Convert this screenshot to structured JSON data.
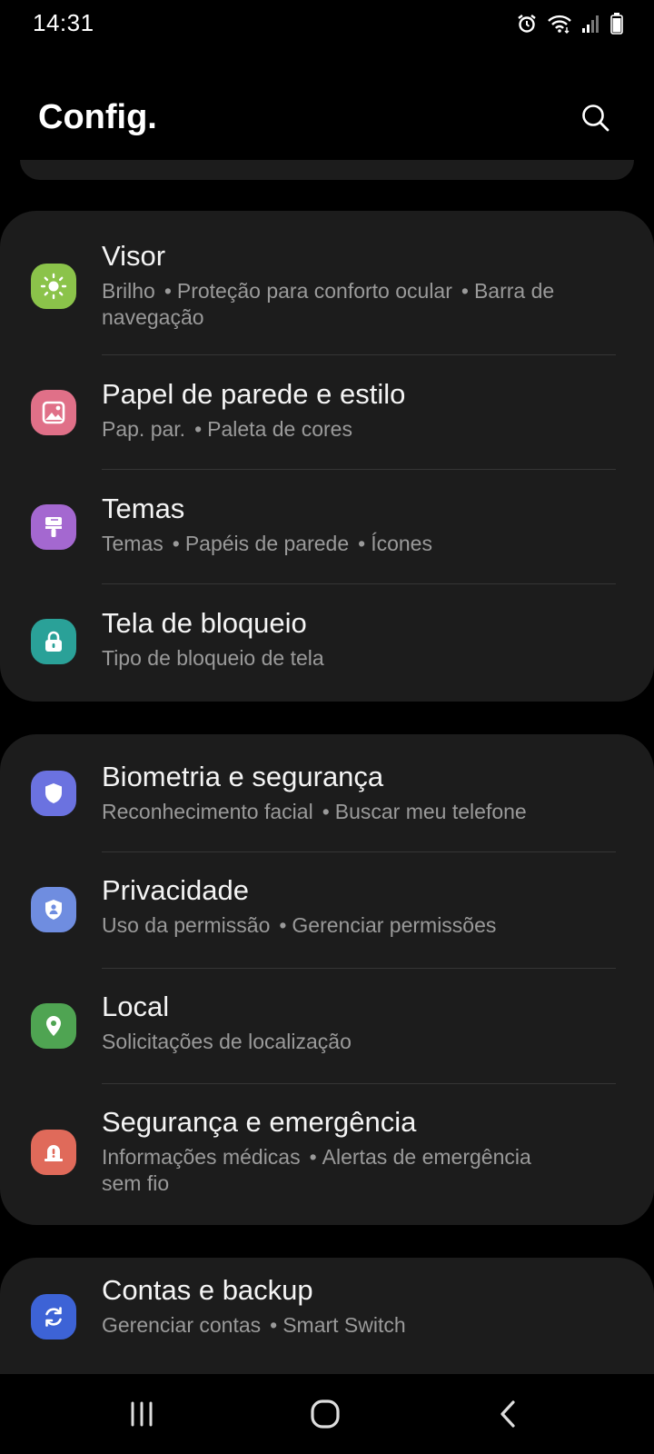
{
  "status_bar": {
    "time": "14:31",
    "icons": [
      "alarm-icon",
      "wifi-icon",
      "signal-icon",
      "battery-icon"
    ]
  },
  "header": {
    "title": "Config.",
    "search_icon": "search-icon"
  },
  "groups": [
    {
      "items": [
        {
          "title": "Visor",
          "icon": "sun-icon",
          "icon_color": "#8bc34a",
          "sub_lines": [
            [
              "Brilho",
              "Proteção para conforto ocular",
              "Barra de"
            ],
            [
              "navegação"
            ]
          ]
        },
        {
          "title": "Papel de parede e estilo",
          "icon": "image-icon",
          "icon_color": "#e07088",
          "sub_lines": [
            [
              "Pap. par.",
              "Paleta de cores"
            ]
          ]
        },
        {
          "title": "Temas",
          "icon": "brush-icon",
          "icon_color": "#a468d0",
          "sub_lines": [
            [
              "Temas",
              "Papéis de parede",
              "Ícones"
            ]
          ]
        },
        {
          "title": "Tela de bloqueio",
          "icon": "lock-icon",
          "icon_color": "#2aa198",
          "sub_lines": [
            [
              "Tipo de bloqueio de tela"
            ]
          ]
        }
      ]
    },
    {
      "items": [
        {
          "title": "Biometria e segurança",
          "icon": "shield-icon",
          "icon_color": "#6b72e0",
          "sub_lines": [
            [
              "Reconhecimento facial",
              "Buscar meu telefone"
            ]
          ]
        },
        {
          "title": "Privacidade",
          "icon": "privacy-shield-icon",
          "icon_color": "#6f8de0",
          "sub_lines": [
            [
              "Uso da permissão",
              "Gerenciar permissões"
            ]
          ]
        },
        {
          "title": "Local",
          "icon": "location-pin-icon",
          "icon_color": "#4fa452",
          "sub_lines": [
            [
              "Solicitações de localização"
            ]
          ]
        },
        {
          "title": "Segurança e emergência",
          "icon": "emergency-icon",
          "icon_color": "#e06a5a",
          "sub_lines": [
            [
              "Informações médicas",
              "Alertas de emergência"
            ],
            [
              "sem fio"
            ]
          ]
        }
      ]
    },
    {
      "items": [
        {
          "title": "Contas e backup",
          "icon": "sync-icon",
          "icon_color": "#3d63d6",
          "sub_lines": [
            [
              "Gerenciar contas",
              "Smart Switch"
            ]
          ]
        }
      ]
    }
  ],
  "nav_bar": {
    "buttons": [
      "recents-button",
      "home-button",
      "back-button"
    ]
  }
}
